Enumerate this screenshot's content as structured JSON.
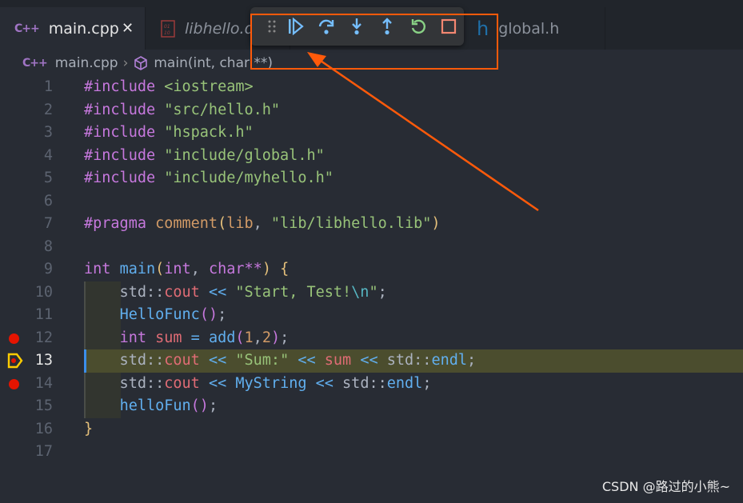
{
  "tabs": [
    {
      "label": "main.cpp",
      "icon": "cpp-icon",
      "active": true,
      "close": "✕"
    },
    {
      "label": "libhello.dll",
      "icon": "binary-file-icon"
    },
    {
      "label": "global.h",
      "icon": "header-file-icon",
      "glyph": "h"
    }
  ],
  "breadcrumb": {
    "file": "main.cpp",
    "symbol": "main(int, char **)",
    "cpp_glyph": "C++"
  },
  "debug_toolbar": [
    "drag-handle",
    "continue",
    "step-over",
    "step-into",
    "step-out",
    "restart",
    "stop"
  ],
  "colors": {
    "highlight": "#ff5a0a",
    "current_line": "#4b4d2e",
    "breakpoint": "#e51400"
  },
  "breakpoints": [
    12,
    14
  ],
  "current_line": 13,
  "lines": [
    [
      [
        "#include",
        "k"
      ],
      [
        " <iostream>",
        "s"
      ]
    ],
    [
      [
        "#include",
        "k"
      ],
      [
        " \"src/hello.h\"",
        "s"
      ]
    ],
    [
      [
        "#include",
        "k"
      ],
      [
        " \"hspack.h\"",
        "s"
      ]
    ],
    [
      [
        "#include",
        "k"
      ],
      [
        " \"include/global.h\"",
        "s"
      ]
    ],
    [
      [
        "#include",
        "k"
      ],
      [
        " \"include/myhello.h\"",
        "s"
      ]
    ],
    [],
    [
      [
        "#pragma",
        "k"
      ],
      [
        " ",
        "p"
      ],
      [
        "comment",
        "n"
      ],
      [
        "(",
        "y"
      ],
      [
        "lib",
        "n"
      ],
      [
        ", ",
        "p"
      ],
      [
        "\"lib/libhello.lib\"",
        "s"
      ],
      [
        ")",
        "y"
      ]
    ],
    [],
    [
      [
        "int",
        "k"
      ],
      [
        " ",
        "p"
      ],
      [
        "main",
        "f"
      ],
      [
        "(",
        "y"
      ],
      [
        "int",
        "k"
      ],
      [
        ", ",
        "p"
      ],
      [
        "char",
        "k"
      ],
      [
        "**",
        "k"
      ],
      [
        ")",
        "y"
      ],
      [
        " ",
        "p"
      ],
      [
        "{",
        "y"
      ]
    ],
    [
      [
        "    std::",
        "p"
      ],
      [
        "cout",
        "v"
      ],
      [
        " << ",
        "f"
      ],
      [
        "\"Start, Test!",
        "s"
      ],
      [
        "\\n",
        "e"
      ],
      [
        "\"",
        "s"
      ],
      [
        ";",
        "p"
      ]
    ],
    [
      [
        "    ",
        "p"
      ],
      [
        "HelloFunc",
        "f"
      ],
      [
        "()",
        "pp"
      ],
      [
        ";",
        "p"
      ]
    ],
    [
      [
        "    ",
        "p"
      ],
      [
        "int",
        "k"
      ],
      [
        " ",
        "p"
      ],
      [
        "sum",
        "v"
      ],
      [
        " = ",
        "f"
      ],
      [
        "add",
        "f"
      ],
      [
        "(",
        "pp"
      ],
      [
        "1",
        "n"
      ],
      [
        ",",
        "p"
      ],
      [
        "2",
        "n"
      ],
      [
        ")",
        "pp"
      ],
      [
        ";",
        "p"
      ]
    ],
    [
      [
        "    std::",
        "p"
      ],
      [
        "cout",
        "v"
      ],
      [
        " << ",
        "f"
      ],
      [
        "\"Sum:\"",
        "s"
      ],
      [
        " << ",
        "f"
      ],
      [
        "sum",
        "v"
      ],
      [
        " << ",
        "f"
      ],
      [
        "std::",
        "p"
      ],
      [
        "endl",
        "f"
      ],
      [
        ";",
        "p"
      ]
    ],
    [
      [
        "    std::",
        "p"
      ],
      [
        "cout",
        "v"
      ],
      [
        " << ",
        "f"
      ],
      [
        "MyString",
        "f"
      ],
      [
        " << ",
        "f"
      ],
      [
        "std::",
        "p"
      ],
      [
        "endl",
        "f"
      ],
      [
        ";",
        "p"
      ]
    ],
    [
      [
        "    ",
        "p"
      ],
      [
        "helloFun",
        "f"
      ],
      [
        "()",
        "pp"
      ],
      [
        ";",
        "p"
      ]
    ],
    [
      [
        "}",
        "y"
      ]
    ],
    []
  ],
  "watermark": "CSDN @路过的小熊~"
}
